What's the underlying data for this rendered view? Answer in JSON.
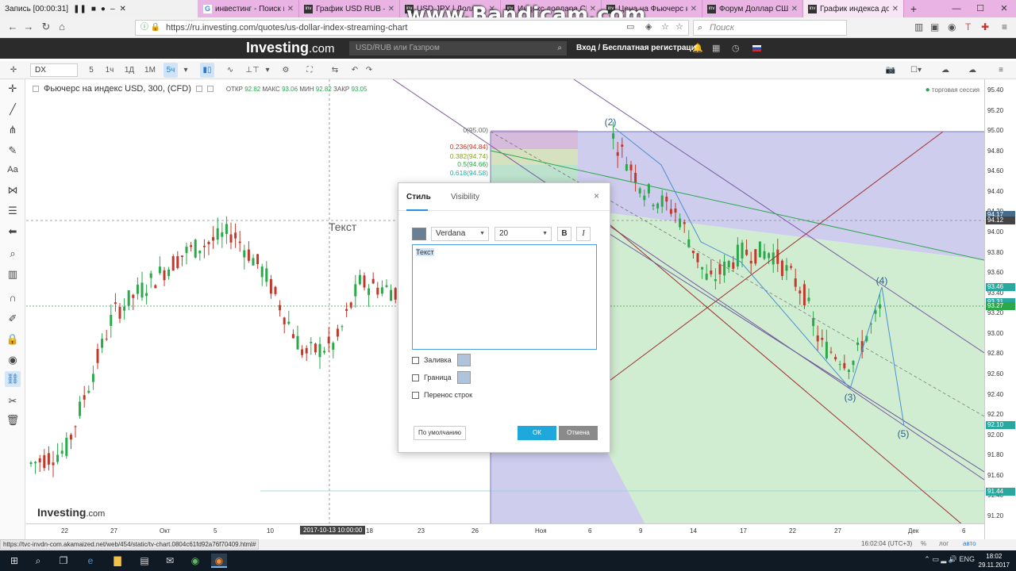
{
  "recorder": {
    "label": "Запись [00:00:31]",
    "watermark": "www.Bandicam.com"
  },
  "tabs": [
    {
      "title": "инвестинг - Поиск в Go",
      "icon": "google",
      "active": false
    },
    {
      "title": "График USD RUB – Inves",
      "icon": "investing",
      "active": false
    },
    {
      "title": "USD JPY | Доллар США",
      "icon": "investing",
      "active": false
    },
    {
      "title": "Индекс доллара США",
      "icon": "investing",
      "active": false
    },
    {
      "title": "Цена на Фьючерс на и",
      "icon": "investing",
      "active": false
    },
    {
      "title": "Форум Доллар США Ра",
      "icon": "investing",
      "active": false
    },
    {
      "title": "График индекса доллар",
      "icon": "investing",
      "active": true
    }
  ],
  "browser": {
    "url": "https://ru.investing.com/quotes/us-dollar-index-streaming-chart",
    "search_placeholder": "Поиск"
  },
  "site": {
    "logo": "Investing",
    "logo_domain": ".com",
    "search_placeholder": "USD/RUB или Газпром",
    "login": "Вход / Бесплатная регистрация"
  },
  "chart_toolbar": {
    "symbol": "DX",
    "intervals": [
      "5",
      "1ч",
      "1Д",
      "1М",
      "5ч"
    ],
    "selected_interval": "5ч"
  },
  "chart": {
    "title": "Фьючерс на индекс USD, 300, (CFD)",
    "ohlc": {
      "open_label": "ОТКР",
      "open": "92.82",
      "high_label": "МАКС",
      "high": "93.06",
      "low_label": "МИН",
      "low": "92.82",
      "close_label": "ЗАКР",
      "close": "93.05"
    },
    "session": "торговая сессия",
    "text_label": "Текст",
    "logo": "Investing",
    "logo_domain": ".com",
    "fib_levels": [
      "0(95.00)",
      "0.236(94.84)",
      "0.382(94.74)",
      "0.5(94.66)",
      "0.618(94.58)"
    ],
    "wave_labels": [
      "(2)",
      "(3)",
      "(4)",
      "(5)"
    ],
    "cursor_time": "2017-10-13 10:00:00"
  },
  "chart_data": {
    "type": "candlestick",
    "title": "Фьючерс на индекс USD, 300, (CFD)",
    "y_range": [
      91.2,
      95.4
    ],
    "y_ticks": [
      "95.40",
      "95.20",
      "95.00",
      "94.80",
      "94.60",
      "94.40",
      "94.20",
      "94.00",
      "93.80",
      "93.60",
      "93.40",
      "93.20",
      "93.00",
      "92.80",
      "92.60",
      "92.40",
      "92.20",
      "92.00",
      "91.80",
      "91.60",
      "91.40",
      "91.20"
    ],
    "x_ticks": [
      "22",
      "27",
      "Окт",
      "5",
      "10",
      "18",
      "23",
      "26",
      "Ноя",
      "6",
      "9",
      "14",
      "17",
      "22",
      "27",
      "Дек",
      "6"
    ],
    "price_badges": [
      {
        "value": "94.17",
        "color": "#4a6a8a"
      },
      {
        "value": "94.12",
        "color": "#444444"
      },
      {
        "value": "93.46",
        "color": "#2aa8a0"
      },
      {
        "value": "93.31",
        "color": "#2aa8a0"
      },
      {
        "value": "93.27",
        "color": "#2aa84a"
      },
      {
        "value": "92.10",
        "color": "#2aa8a0"
      },
      {
        "value": "91.44",
        "color": "#2aa8a0"
      }
    ],
    "bull_color": "#2aa84a",
    "bear_color": "#c0392b"
  },
  "dialog": {
    "tab_style": "Стиль",
    "tab_visibility": "Visibility",
    "font": "Verdana",
    "size": "20",
    "bold": "B",
    "italic": "I",
    "text": "Текст",
    "fill_label": "Заливка",
    "border_label": "Граница",
    "wrap_label": "Перенос строк",
    "default_btn": "По умолчанию",
    "ok_btn": "ОК",
    "cancel_btn": "Отмена",
    "text_color": "#6b7f92"
  },
  "statusbar": {
    "url": "https://tvc-invdn-com.akamaized.net/web/454/static/tv-chart.0804c61fd92a76f70409.html#",
    "clock": "16:02:04 (UTC+3)",
    "pct": "%",
    "log": "лог",
    "auto": "авто"
  },
  "taskbar": {
    "lang": "ENG",
    "time": "18:02",
    "date": "29.11.2017"
  }
}
